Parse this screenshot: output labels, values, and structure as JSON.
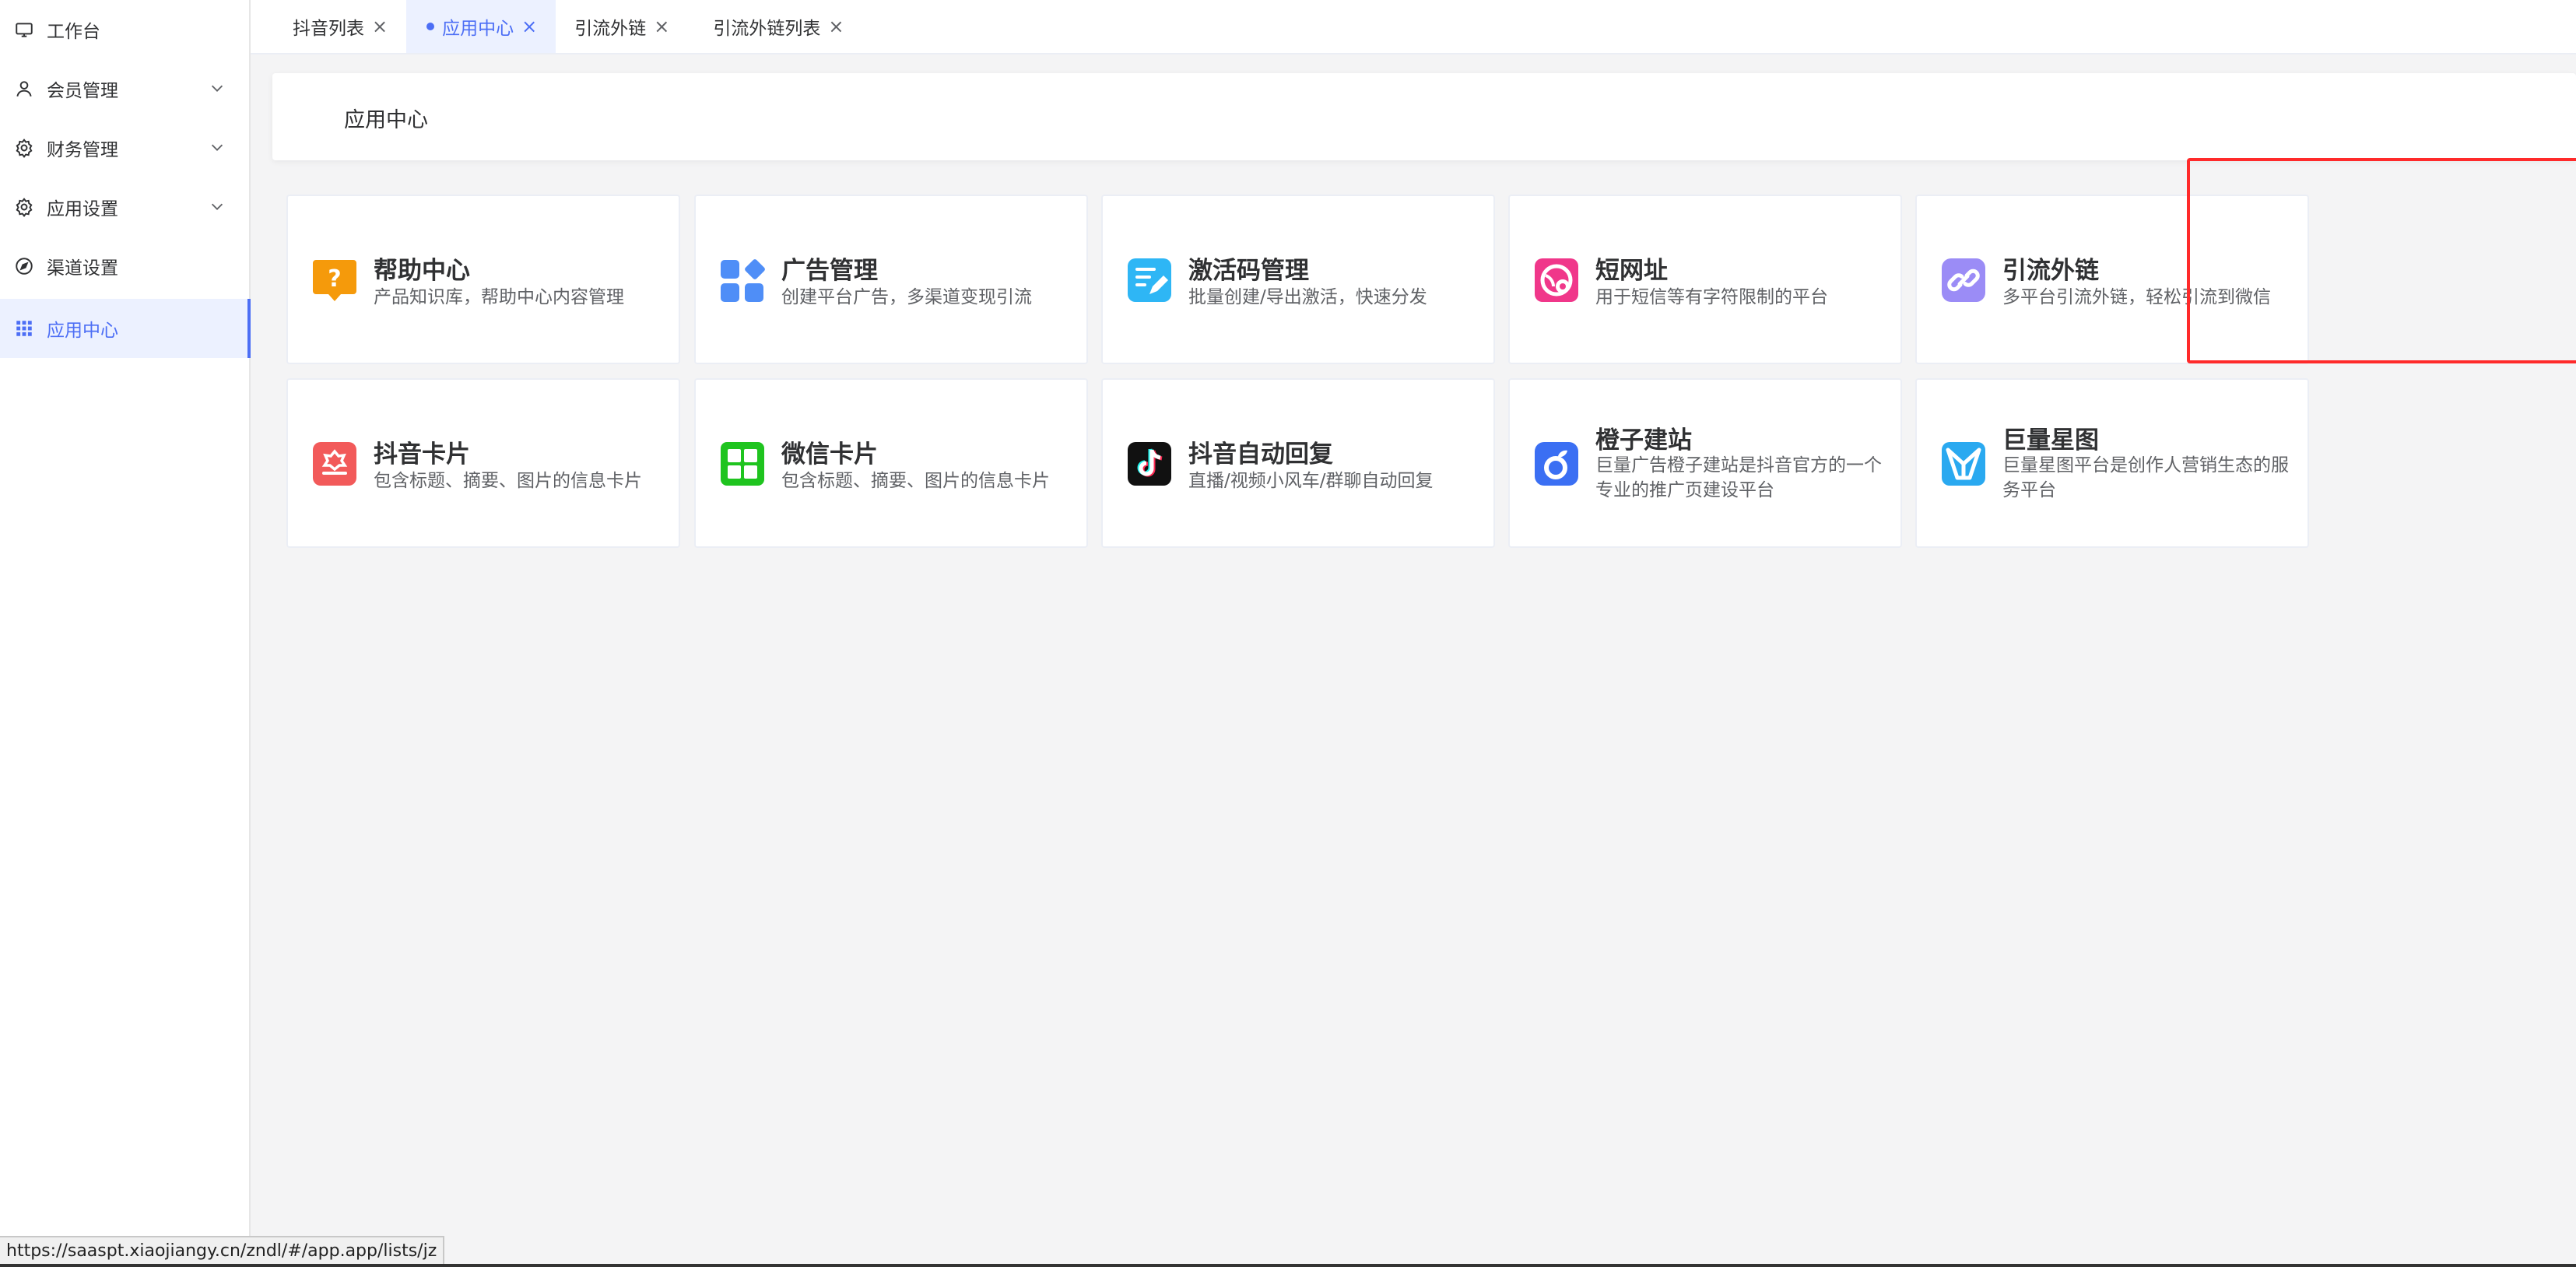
{
  "sidebar": {
    "items": [
      {
        "label": "工作台",
        "icon": "monitor-icon",
        "expandable": false,
        "active": false
      },
      {
        "label": "会员管理",
        "icon": "user-icon",
        "expandable": true,
        "active": false
      },
      {
        "label": "财务管理",
        "icon": "gear-icon",
        "expandable": true,
        "active": false
      },
      {
        "label": "应用设置",
        "icon": "gear-icon",
        "expandable": true,
        "active": false
      },
      {
        "label": "渠道设置",
        "icon": "compass-icon",
        "expandable": false,
        "active": false
      },
      {
        "label": "应用中心",
        "icon": "grid-icon",
        "expandable": false,
        "active": true
      }
    ]
  },
  "tabs": [
    {
      "label": "抖音列表",
      "active": false
    },
    {
      "label": "应用中心",
      "active": true
    },
    {
      "label": "引流外链",
      "active": false
    },
    {
      "label": "引流外链列表",
      "active": false
    }
  ],
  "page": {
    "title": "应用中心"
  },
  "apps": [
    {
      "title": "帮助中心",
      "desc": "产品知识库，帮助中心内容管理",
      "icon": "help-icon",
      "color": "#f59a0b"
    },
    {
      "title": "广告管理",
      "desc": "创建平台广告，多渠道变现引流",
      "icon": "ad-blocks-icon",
      "color": "#4f8ef7"
    },
    {
      "title": "激活码管理",
      "desc": "批量创建/导出激活，快速分发",
      "icon": "edit-doc-icon",
      "color": "#2eb6f5"
    },
    {
      "title": "短网址",
      "desc": "用于短信等有字符限制的平台",
      "icon": "short-url-icon",
      "color": "#f0378a"
    },
    {
      "title": "引流外链",
      "desc": "多平台引流外链，轻松引流到微信",
      "icon": "link-icon",
      "color": "#9b8cf6"
    },
    {
      "title": "抖音卡片",
      "desc": "包含标题、摘要、图片的信息卡片",
      "icon": "douyin-card-icon",
      "color": "#f25a5a"
    },
    {
      "title": "微信卡片",
      "desc": "包含标题、摘要、图片的信息卡片",
      "icon": "wechat-card-icon",
      "color": "#1fc41f"
    },
    {
      "title": "抖音自动回复",
      "desc": "直播/视频小风车/群聊自动回复",
      "icon": "tiktok-icon",
      "color": "#111111"
    },
    {
      "title": "橙子建站",
      "desc": "巨量广告橙子建站是抖音官方的一个专业的推广页建设平台",
      "icon": "orange-site-icon",
      "color": "#3b6ff3"
    },
    {
      "title": "巨量星图",
      "desc": "巨量星图平台是创作人营销生态的服务平台",
      "icon": "xingtu-icon",
      "color": "#2aa9f0"
    }
  ],
  "status_url": "https://saaspt.xiaojiangy.cn/zndl/#/app.app/lists/jz",
  "colors": {
    "accent": "#4c6ef5",
    "highlight": "#ff2a2a"
  }
}
